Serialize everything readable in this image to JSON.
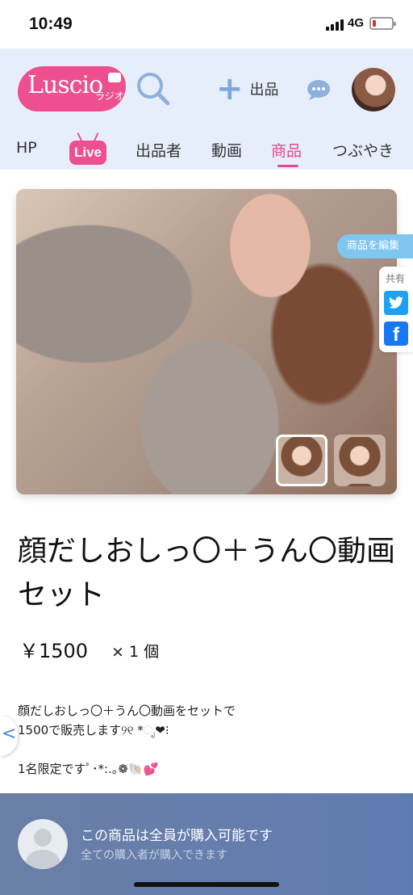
{
  "status": {
    "time": "10:49",
    "network": "4G"
  },
  "header": {
    "logo_text": "Luscio",
    "logo_sub": "ラジオ",
    "post_label": "出品",
    "tabs": [
      {
        "label": "HP"
      },
      {
        "label": "Live"
      },
      {
        "label": "出品者"
      },
      {
        "label": "動画"
      },
      {
        "label": "商品",
        "active": true
      },
      {
        "label": "つぶやき"
      }
    ]
  },
  "product": {
    "edit_label": "商品を編集",
    "share_label": "共有",
    "title": "顔だしおしっ〇＋うん〇動画セット",
    "price": "￥1500",
    "quantity": "× 1 個",
    "description": "顔だしおしっ〇＋うん〇動画をセットで\n1500で販売します୨୧ *ೃ❤︎⁝\n\n1名限定ですﾟ･*:.｡❁🐚💕"
  },
  "footer": {
    "title": "この商品は全員が購入可能です",
    "subtitle": "全ての購入者が購入できます"
  },
  "colors": {
    "accent": "#e2488a",
    "header_bg": "#e7eefb",
    "footer_bg": "#5f7cb1"
  }
}
